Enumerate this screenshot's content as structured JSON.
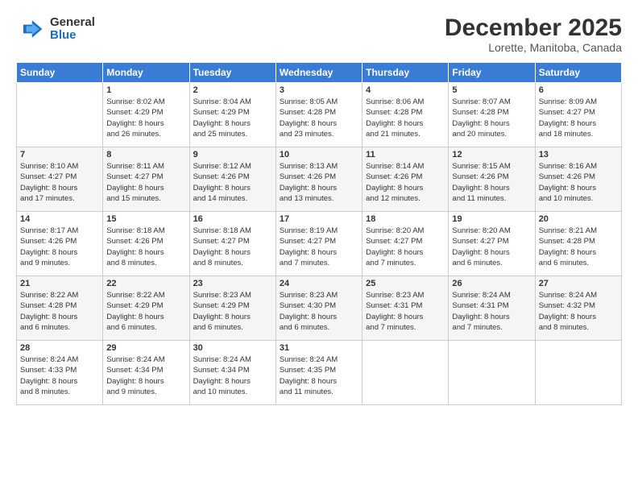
{
  "header": {
    "logo_general": "General",
    "logo_blue": "Blue",
    "month_title": "December 2025",
    "location": "Lorette, Manitoba, Canada"
  },
  "days_of_week": [
    "Sunday",
    "Monday",
    "Tuesday",
    "Wednesday",
    "Thursday",
    "Friday",
    "Saturday"
  ],
  "weeks": [
    [
      {
        "day": "",
        "info": ""
      },
      {
        "day": "1",
        "info": "Sunrise: 8:02 AM\nSunset: 4:29 PM\nDaylight: 8 hours\nand 26 minutes."
      },
      {
        "day": "2",
        "info": "Sunrise: 8:04 AM\nSunset: 4:29 PM\nDaylight: 8 hours\nand 25 minutes."
      },
      {
        "day": "3",
        "info": "Sunrise: 8:05 AM\nSunset: 4:28 PM\nDaylight: 8 hours\nand 23 minutes."
      },
      {
        "day": "4",
        "info": "Sunrise: 8:06 AM\nSunset: 4:28 PM\nDaylight: 8 hours\nand 21 minutes."
      },
      {
        "day": "5",
        "info": "Sunrise: 8:07 AM\nSunset: 4:28 PM\nDaylight: 8 hours\nand 20 minutes."
      },
      {
        "day": "6",
        "info": "Sunrise: 8:09 AM\nSunset: 4:27 PM\nDaylight: 8 hours\nand 18 minutes."
      }
    ],
    [
      {
        "day": "7",
        "info": "Sunrise: 8:10 AM\nSunset: 4:27 PM\nDaylight: 8 hours\nand 17 minutes."
      },
      {
        "day": "8",
        "info": "Sunrise: 8:11 AM\nSunset: 4:27 PM\nDaylight: 8 hours\nand 15 minutes."
      },
      {
        "day": "9",
        "info": "Sunrise: 8:12 AM\nSunset: 4:26 PM\nDaylight: 8 hours\nand 14 minutes."
      },
      {
        "day": "10",
        "info": "Sunrise: 8:13 AM\nSunset: 4:26 PM\nDaylight: 8 hours\nand 13 minutes."
      },
      {
        "day": "11",
        "info": "Sunrise: 8:14 AM\nSunset: 4:26 PM\nDaylight: 8 hours\nand 12 minutes."
      },
      {
        "day": "12",
        "info": "Sunrise: 8:15 AM\nSunset: 4:26 PM\nDaylight: 8 hours\nand 11 minutes."
      },
      {
        "day": "13",
        "info": "Sunrise: 8:16 AM\nSunset: 4:26 PM\nDaylight: 8 hours\nand 10 minutes."
      }
    ],
    [
      {
        "day": "14",
        "info": "Sunrise: 8:17 AM\nSunset: 4:26 PM\nDaylight: 8 hours\nand 9 minutes."
      },
      {
        "day": "15",
        "info": "Sunrise: 8:18 AM\nSunset: 4:26 PM\nDaylight: 8 hours\nand 8 minutes."
      },
      {
        "day": "16",
        "info": "Sunrise: 8:18 AM\nSunset: 4:27 PM\nDaylight: 8 hours\nand 8 minutes."
      },
      {
        "day": "17",
        "info": "Sunrise: 8:19 AM\nSunset: 4:27 PM\nDaylight: 8 hours\nand 7 minutes."
      },
      {
        "day": "18",
        "info": "Sunrise: 8:20 AM\nSunset: 4:27 PM\nDaylight: 8 hours\nand 7 minutes."
      },
      {
        "day": "19",
        "info": "Sunrise: 8:20 AM\nSunset: 4:27 PM\nDaylight: 8 hours\nand 6 minutes."
      },
      {
        "day": "20",
        "info": "Sunrise: 8:21 AM\nSunset: 4:28 PM\nDaylight: 8 hours\nand 6 minutes."
      }
    ],
    [
      {
        "day": "21",
        "info": "Sunrise: 8:22 AM\nSunset: 4:28 PM\nDaylight: 8 hours\nand 6 minutes."
      },
      {
        "day": "22",
        "info": "Sunrise: 8:22 AM\nSunset: 4:29 PM\nDaylight: 8 hours\nand 6 minutes."
      },
      {
        "day": "23",
        "info": "Sunrise: 8:23 AM\nSunset: 4:29 PM\nDaylight: 8 hours\nand 6 minutes."
      },
      {
        "day": "24",
        "info": "Sunrise: 8:23 AM\nSunset: 4:30 PM\nDaylight: 8 hours\nand 6 minutes."
      },
      {
        "day": "25",
        "info": "Sunrise: 8:23 AM\nSunset: 4:31 PM\nDaylight: 8 hours\nand 7 minutes."
      },
      {
        "day": "26",
        "info": "Sunrise: 8:24 AM\nSunset: 4:31 PM\nDaylight: 8 hours\nand 7 minutes."
      },
      {
        "day": "27",
        "info": "Sunrise: 8:24 AM\nSunset: 4:32 PM\nDaylight: 8 hours\nand 8 minutes."
      }
    ],
    [
      {
        "day": "28",
        "info": "Sunrise: 8:24 AM\nSunset: 4:33 PM\nDaylight: 8 hours\nand 8 minutes."
      },
      {
        "day": "29",
        "info": "Sunrise: 8:24 AM\nSunset: 4:34 PM\nDaylight: 8 hours\nand 9 minutes."
      },
      {
        "day": "30",
        "info": "Sunrise: 8:24 AM\nSunset: 4:34 PM\nDaylight: 8 hours\nand 10 minutes."
      },
      {
        "day": "31",
        "info": "Sunrise: 8:24 AM\nSunset: 4:35 PM\nDaylight: 8 hours\nand 11 minutes."
      },
      {
        "day": "",
        "info": ""
      },
      {
        "day": "",
        "info": ""
      },
      {
        "day": "",
        "info": ""
      }
    ]
  ]
}
